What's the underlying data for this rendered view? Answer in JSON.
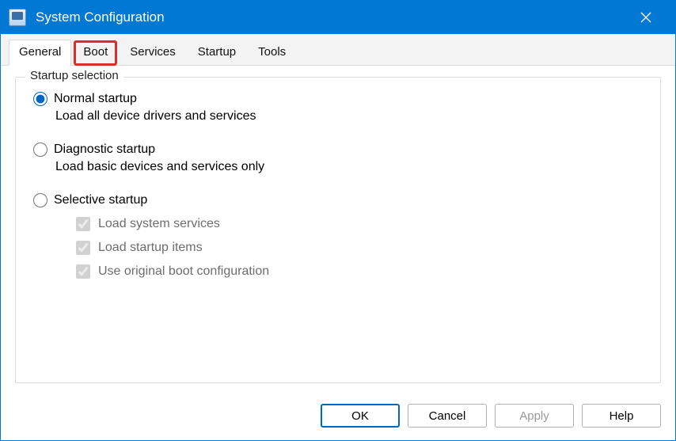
{
  "titlebar": {
    "title": "System Configuration"
  },
  "tabs": {
    "general": "General",
    "boot": "Boot",
    "services": "Services",
    "startup": "Startup",
    "tools": "Tools"
  },
  "group": {
    "label": "Startup selection",
    "normal": {
      "label": "Normal startup",
      "desc": "Load all device drivers and services"
    },
    "diagnostic": {
      "label": "Diagnostic startup",
      "desc": "Load basic devices and services only"
    },
    "selective": {
      "label": "Selective startup",
      "load_services": "Load system services",
      "load_startup": "Load startup items",
      "original_boot": "Use original boot configuration"
    }
  },
  "buttons": {
    "ok": "OK",
    "cancel": "Cancel",
    "apply": "Apply",
    "help": "Help"
  }
}
